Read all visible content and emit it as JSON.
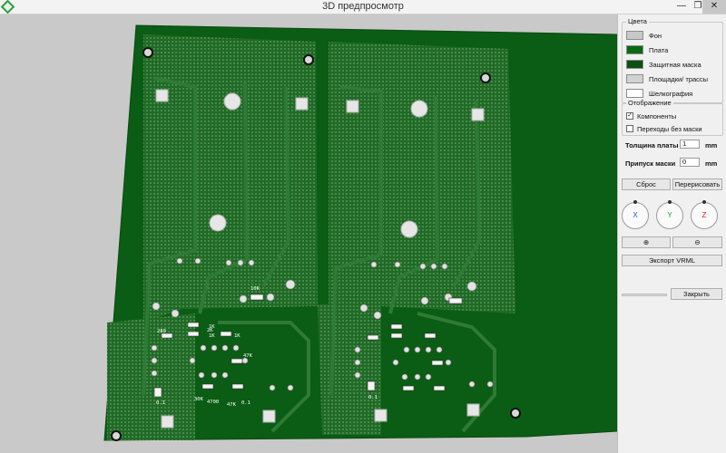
{
  "window": {
    "title": "3D предпросмотр",
    "min_glyph": "—",
    "max_glyph": "❐",
    "close_glyph": "✕"
  },
  "colors": {
    "section_title": "Цвета",
    "items": [
      {
        "label": "Фон",
        "color": "#c8c8c8"
      },
      {
        "label": "Плата",
        "color": "#0a6a12"
      },
      {
        "label": "Защитная маска",
        "color": "#0b4f12"
      },
      {
        "label": "Площадки/ трассы",
        "color": "#d2d2d2"
      },
      {
        "label": "Шелкография",
        "color": "#ffffff"
      }
    ]
  },
  "display": {
    "section_title": "Отображение",
    "components_label": "Компоненты",
    "components_checked": true,
    "vias_label": "Переходы без маски",
    "vias_checked": false
  },
  "board_thickness": {
    "label": "Толщина платы",
    "value": "1",
    "unit": "mm"
  },
  "mask_margin": {
    "label": "Припуск маски",
    "value": "0",
    "unit": "mm"
  },
  "buttons": {
    "reset": "Сброс",
    "redraw": "Перерисовать",
    "zoom_in": "⊕",
    "zoom_out": "⊖",
    "export_vrml": "Экспорт VRML",
    "close": "Закрыть"
  },
  "rotation": {
    "x": {
      "label": "X",
      "color": "#1d5fd6"
    },
    "y": {
      "label": "Y",
      "color": "#1d9a2a"
    },
    "z": {
      "label": "Z",
      "color": "#d62020"
    }
  },
  "pcb": {
    "board_color": "#0b5c14",
    "trace_color": "#2f7a36",
    "silkscreen_labels": [
      "10K",
      "2K",
      "1K",
      "1K",
      "1K",
      "280",
      "47K",
      "4700",
      "30K",
      "47K",
      "0.1",
      "0.1",
      "0.1"
    ]
  }
}
